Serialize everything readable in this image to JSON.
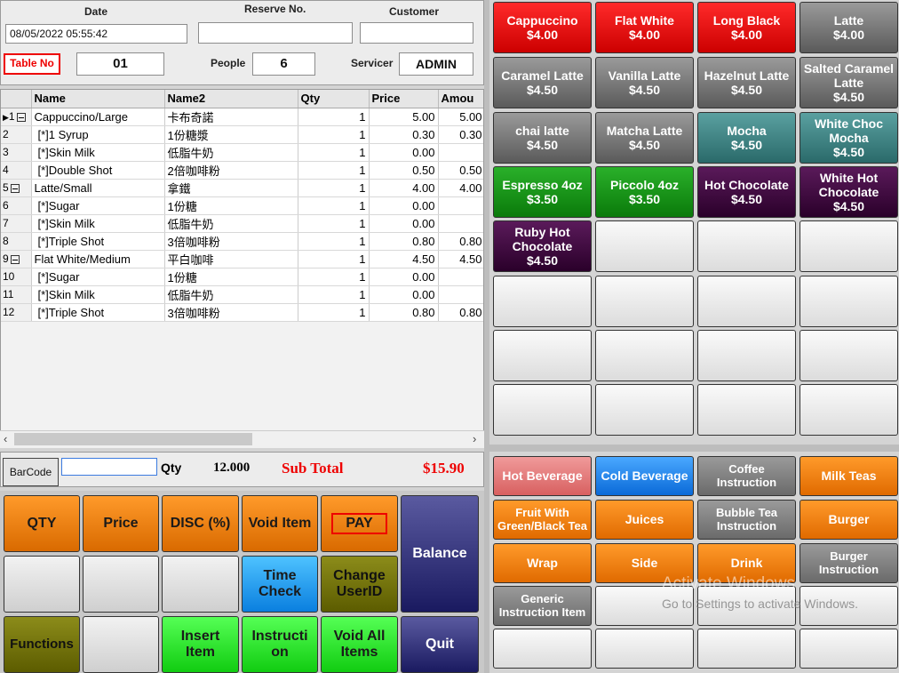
{
  "header": {
    "date_label": "Date",
    "date_value": "08/05/2022 05:55:42",
    "reserve_label": "Reserve No.",
    "reserve_value": "",
    "customer_label": "Customer",
    "customer_value": "",
    "tableno_label": "Table No",
    "tableno_value": "01",
    "people_label": "People",
    "people_value": "6",
    "servicer_label": "Servicer",
    "servicer_value": "ADMIN"
  },
  "grid": {
    "columns": [
      "Name",
      "Name2",
      "Qty",
      "Price",
      "Amou"
    ],
    "rows": [
      {
        "idx": "1",
        "name": "Cappuccino/Large",
        "name2": "卡布奇諾",
        "qty": "1",
        "price": "5.00",
        "amount": "5.00"
      },
      {
        "idx": "2",
        "name": "[*]1 Syrup",
        "name2": "1份糖漿",
        "qty": "1",
        "price": "0.30",
        "amount": "0.30"
      },
      {
        "idx": "3",
        "name": "[*]Skin Milk",
        "name2": "低脂牛奶",
        "qty": "1",
        "price": "0.00",
        "amount": ""
      },
      {
        "idx": "4",
        "name": "[*]Double Shot",
        "name2": "2倍咖啡粉",
        "qty": "1",
        "price": "0.50",
        "amount": "0.50"
      },
      {
        "idx": "5",
        "name": "Latte/Small",
        "name2": "拿鐵",
        "qty": "1",
        "price": "4.00",
        "amount": "4.00"
      },
      {
        "idx": "6",
        "name": "[*]Sugar",
        "name2": "1份糖",
        "qty": "1",
        "price": "0.00",
        "amount": ""
      },
      {
        "idx": "7",
        "name": "[*]Skin Milk",
        "name2": "低脂牛奶",
        "qty": "1",
        "price": "0.00",
        "amount": ""
      },
      {
        "idx": "8",
        "name": "[*]Triple Shot",
        "name2": "3倍咖啡粉",
        "qty": "1",
        "price": "0.80",
        "amount": "0.80"
      },
      {
        "idx": "9",
        "name": "Flat White/Medium",
        "name2": "平白咖啡",
        "qty": "1",
        "price": "4.50",
        "amount": "4.50"
      },
      {
        "idx": "10",
        "name": "[*]Sugar",
        "name2": "1份糖",
        "qty": "1",
        "price": "0.00",
        "amount": ""
      },
      {
        "idx": "11",
        "name": "[*]Skin Milk",
        "name2": "低脂牛奶",
        "qty": "1",
        "price": "0.00",
        "amount": ""
      },
      {
        "idx": "12",
        "name": "[*]Triple Shot",
        "name2": "3倍咖啡粉",
        "qty": "1",
        "price": "0.80",
        "amount": "0.80"
      }
    ]
  },
  "totals": {
    "barcode_label": "BarCode",
    "qty_label": "Qty",
    "qty_value": "12.000",
    "subtotal_label": "Sub Total",
    "subtotal_value": "$15.90"
  },
  "actions": {
    "qty": "QTY",
    "price": "Price",
    "disc": "DISC (%)",
    "void_item": "Void Item",
    "pay": "PAY",
    "balance": "Balance",
    "time_check_1": "Time",
    "time_check_2": "Check",
    "change_user_1": "Change",
    "change_user_2": "UserID",
    "functions": "Functions",
    "insert_1": "Insert",
    "insert_2": "Item",
    "instruction_1": "Instructi",
    "instruction_2": "on",
    "void_all_1": "Void All",
    "void_all_2": "Items",
    "quit": "Quit"
  },
  "menu": [
    {
      "name": "Cappuccino",
      "price": "$4.00",
      "color": "red"
    },
    {
      "name": "Flat White",
      "price": "$4.00",
      "color": "red"
    },
    {
      "name": "Long Black",
      "price": "$4.00",
      "color": "red"
    },
    {
      "name": "Latte",
      "price": "$4.00",
      "color": "grey"
    },
    {
      "name": "Caramel Latte",
      "price": "$4.50",
      "color": "grey"
    },
    {
      "name": "Vanilla Latte",
      "price": "$4.50",
      "color": "grey"
    },
    {
      "name": "Hazelnut Latte",
      "price": "$4.50",
      "color": "grey"
    },
    {
      "name": "Salted Caramel Latte",
      "price": "$4.50",
      "color": "grey"
    },
    {
      "name": "chai latte",
      "price": "$4.50",
      "color": "grey"
    },
    {
      "name": "Matcha Latte",
      "price": "$4.50",
      "color": "grey"
    },
    {
      "name": "Mocha",
      "price": "$4.50",
      "color": "teal"
    },
    {
      "name": "White Choc Mocha",
      "price": "$4.50",
      "color": "teal"
    },
    {
      "name": "Espresso 4oz",
      "price": "$3.50",
      "color": "green"
    },
    {
      "name": "Piccolo 4oz",
      "price": "$3.50",
      "color": "green"
    },
    {
      "name": "Hot Chocolate",
      "price": "$4.50",
      "color": "purple"
    },
    {
      "name": "White Hot Chocolate",
      "price": "$4.50",
      "color": "purple"
    },
    {
      "name": "Ruby Hot Chocolate",
      "price": "$4.50",
      "color": "purple"
    }
  ],
  "categories": [
    {
      "label": "Hot Beverage",
      "color": "pink"
    },
    {
      "label": "Cold Beverage",
      "color": "blue"
    },
    {
      "label": "Coffee Instruction",
      "color": "grey"
    },
    {
      "label": "Milk Teas",
      "color": "orange"
    },
    {
      "label": "Fruit With Green/Black Tea",
      "color": "orange"
    },
    {
      "label": "Juices",
      "color": "orange"
    },
    {
      "label": "Bubble Tea Instruction",
      "color": "grey"
    },
    {
      "label": "Burger",
      "color": "orange"
    },
    {
      "label": "Wrap",
      "color": "orange"
    },
    {
      "label": "Side",
      "color": "orange"
    },
    {
      "label": "Drink",
      "color": "orange"
    },
    {
      "label": "Burger Instruction",
      "color": "grey"
    },
    {
      "label": "Generic Instruction Item",
      "color": "grey"
    }
  ],
  "watermark": {
    "line1": "Activate Windows",
    "line2": "Go to Settings to activate Windows."
  }
}
